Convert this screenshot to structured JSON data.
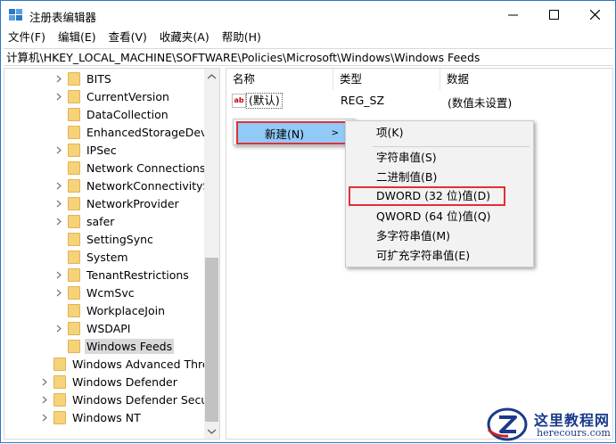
{
  "window": {
    "title": "注册表编辑器",
    "minimize": "—",
    "maximize": "☐",
    "close": "✕"
  },
  "menu": [
    "文件(F)",
    "编辑(E)",
    "查看(V)",
    "收藏夹(A)",
    "帮助(H)"
  ],
  "address": "计算机\\HKEY_LOCAL_MACHINE\\SOFTWARE\\Policies\\Microsoft\\Windows\\Windows Feeds",
  "tree": {
    "items": [
      {
        "label": "BITS",
        "level": 2,
        "expandable": true
      },
      {
        "label": "CurrentVersion",
        "level": 2,
        "expandable": true
      },
      {
        "label": "DataCollection",
        "level": 2,
        "expandable": false
      },
      {
        "label": "EnhancedStorageDevice",
        "level": 2,
        "expandable": false
      },
      {
        "label": "IPSec",
        "level": 2,
        "expandable": true
      },
      {
        "label": "Network Connections",
        "level": 2,
        "expandable": false
      },
      {
        "label": "NetworkConnectivitySta",
        "level": 2,
        "expandable": true
      },
      {
        "label": "NetworkProvider",
        "level": 2,
        "expandable": true
      },
      {
        "label": "safer",
        "level": 2,
        "expandable": true
      },
      {
        "label": "SettingSync",
        "level": 2,
        "expandable": false
      },
      {
        "label": "System",
        "level": 2,
        "expandable": false
      },
      {
        "label": "TenantRestrictions",
        "level": 2,
        "expandable": true
      },
      {
        "label": "WcmSvc",
        "level": 2,
        "expandable": true
      },
      {
        "label": "WorkplaceJoin",
        "level": 2,
        "expandable": false
      },
      {
        "label": "WSDAPI",
        "level": 2,
        "expandable": true
      },
      {
        "label": "Windows Feeds",
        "level": 2,
        "expandable": false,
        "selected": true
      },
      {
        "label": "Windows Advanced Threa",
        "level": 1,
        "expandable": false
      },
      {
        "label": "Windows Defender",
        "level": 1,
        "expandable": true
      },
      {
        "label": "Windows Defender Securit",
        "level": 1,
        "expandable": true
      },
      {
        "label": "Windows NT",
        "level": 1,
        "expandable": true
      }
    ]
  },
  "columns": {
    "name": "名称",
    "type": "类型",
    "data": "数据"
  },
  "values": [
    {
      "icon": "ab",
      "name": "(默认)",
      "type": "REG_SZ",
      "data": "(数值未设置)"
    }
  ],
  "context_menu": {
    "new_label": "新建(N)",
    "arrow": ">"
  },
  "submenu": {
    "items": [
      {
        "label": "项(K)"
      },
      {
        "label": "字符串值(S)"
      },
      {
        "label": "二进制值(B)"
      },
      {
        "label": "DWORD (32 位)值(D)",
        "highlight": true
      },
      {
        "label": "QWORD (64 位)值(Q)"
      },
      {
        "label": "多字符串值(M)"
      },
      {
        "label": "可扩充字符串值(E)"
      }
    ]
  },
  "watermark": {
    "title": "这里教程网",
    "url": "herecours.com"
  },
  "colors": {
    "accent": "#2b78c5",
    "selection": "#91c9f7",
    "highlight_border": "#e03038",
    "folder": "#f6d27a"
  }
}
